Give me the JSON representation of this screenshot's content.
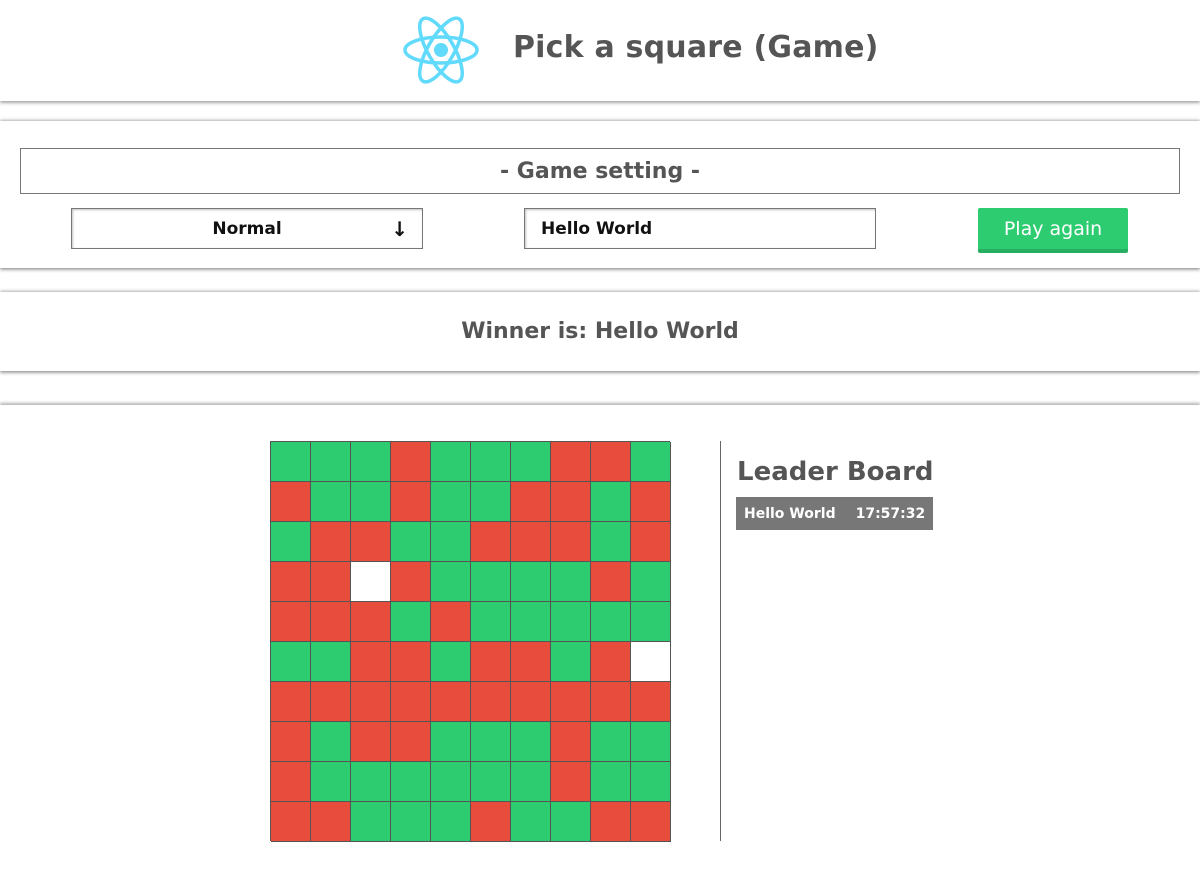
{
  "header": {
    "title": "Pick a square (Game)",
    "logo_icon": "react-atom-icon",
    "logo_color": "#61dafb"
  },
  "settings": {
    "title": "- Game setting -",
    "mode_selected": "Normal",
    "mode_arrow_icon": "arrow-down-icon",
    "player_name": "Hello World",
    "play_again_label": "Play again"
  },
  "winner": {
    "text": "Winner is: Hello World"
  },
  "board": {
    "size": 10,
    "colors": {
      "G": "#2ecc71",
      "R": "#e74c3c",
      "W": "#ffffff"
    },
    "rows": [
      "GGGRGGGRRG",
      "RGGRGGRRGR",
      "GRRGGRRRGR",
      "RRWRGGGGRG",
      "RRRGRGGGGG",
      "GGRRGRRGRW",
      "RRRRRRRRRR",
      "RGRRGGGRGG",
      "RGGGGGGRGG",
      "RRGGGRGGRR"
    ]
  },
  "leaderboard": {
    "title": "Leader Board",
    "entries": [
      {
        "name": "Hello World",
        "time": "17:57:32"
      }
    ]
  }
}
